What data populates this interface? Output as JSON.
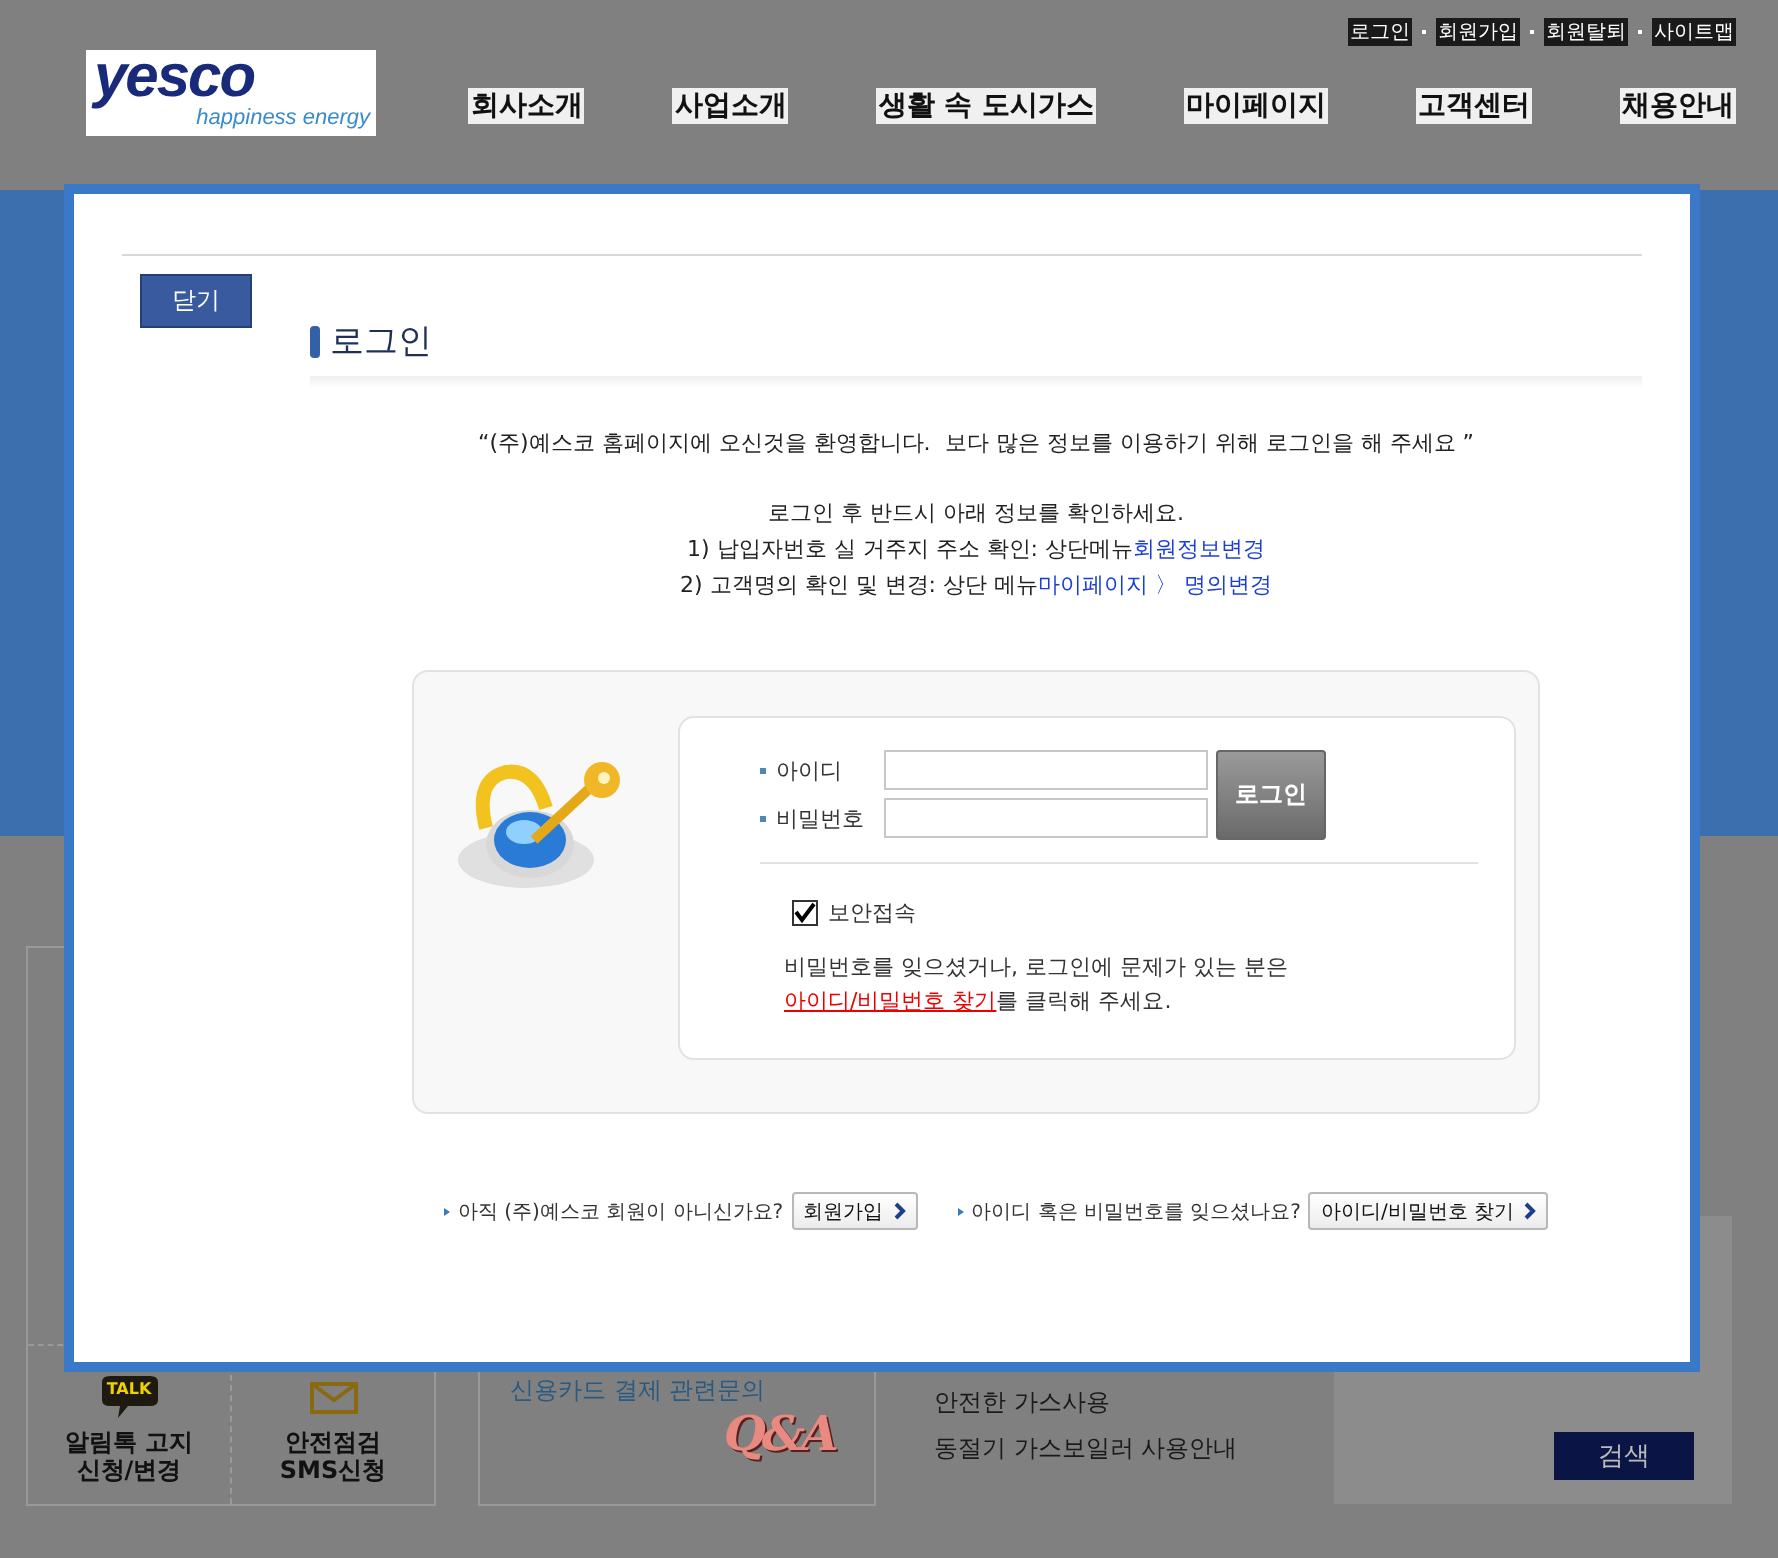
{
  "header": {
    "top_links": [
      "로그인",
      "회원가입",
      "회원탈퇴",
      "사이트맵"
    ],
    "logo": {
      "text": "yesco",
      "tagline": "happiness energy"
    },
    "nav": [
      "회사소개",
      "사업소개",
      "생활 속 도시가스",
      "마이페이지",
      "고객센터",
      "채용안내"
    ]
  },
  "background": {
    "quick_links": [
      {
        "kind": "talk",
        "icon_text": "TALK",
        "label": "알림톡 고지",
        "sublabel": "신청/변경"
      },
      {
        "kind": "mail",
        "label": "안전점검",
        "sublabel": "SMS신청"
      }
    ],
    "qa": {
      "text": "신용카드 결제 관련문의",
      "art": "Q&A"
    },
    "guides": [
      "안전한 가스사용",
      "동절기 가스보일러 사용안내"
    ],
    "search_button": "검색"
  },
  "modal": {
    "close_button": "닫기",
    "title": "로그인",
    "welcome": "“(주)예스코 홈페이지에 오신것을 환영합니다.  보다 많은 정보를 이용하기 위해 로그인을 해 주세요 ”",
    "notice_heading": "로그인 후 반드시 아래 정보를 확인하세요.",
    "notices": [
      {
        "text": "1) 납입자번호 실 거주지 주소 확인: 상단메뉴",
        "link": "회원정보변경"
      },
      {
        "text": "2) 고객명의 확인 및 변경: 상단 메뉴",
        "link": "마이페이지 〉 명의변경"
      }
    ],
    "fields": [
      {
        "label": "아이디"
      },
      {
        "label": "비밀번호"
      }
    ],
    "login_button": "로그인",
    "secure": {
      "label": "보안접속",
      "checked": true
    },
    "help": {
      "text": "비밀번호를 잊으셨거나, 로그인에 문제가 있는 분은",
      "link": "아이디/비밀번호 찾기",
      "suffix": "를 클릭해 주세요."
    },
    "footer": [
      {
        "question": "아직 (주)예스코 회원이 아니신가요?",
        "button": "회원가입"
      },
      {
        "question": "아이디 혹은 비밀번호를 잊으셨나요?",
        "button": "아이디/비밀번호 찾기"
      }
    ]
  }
}
